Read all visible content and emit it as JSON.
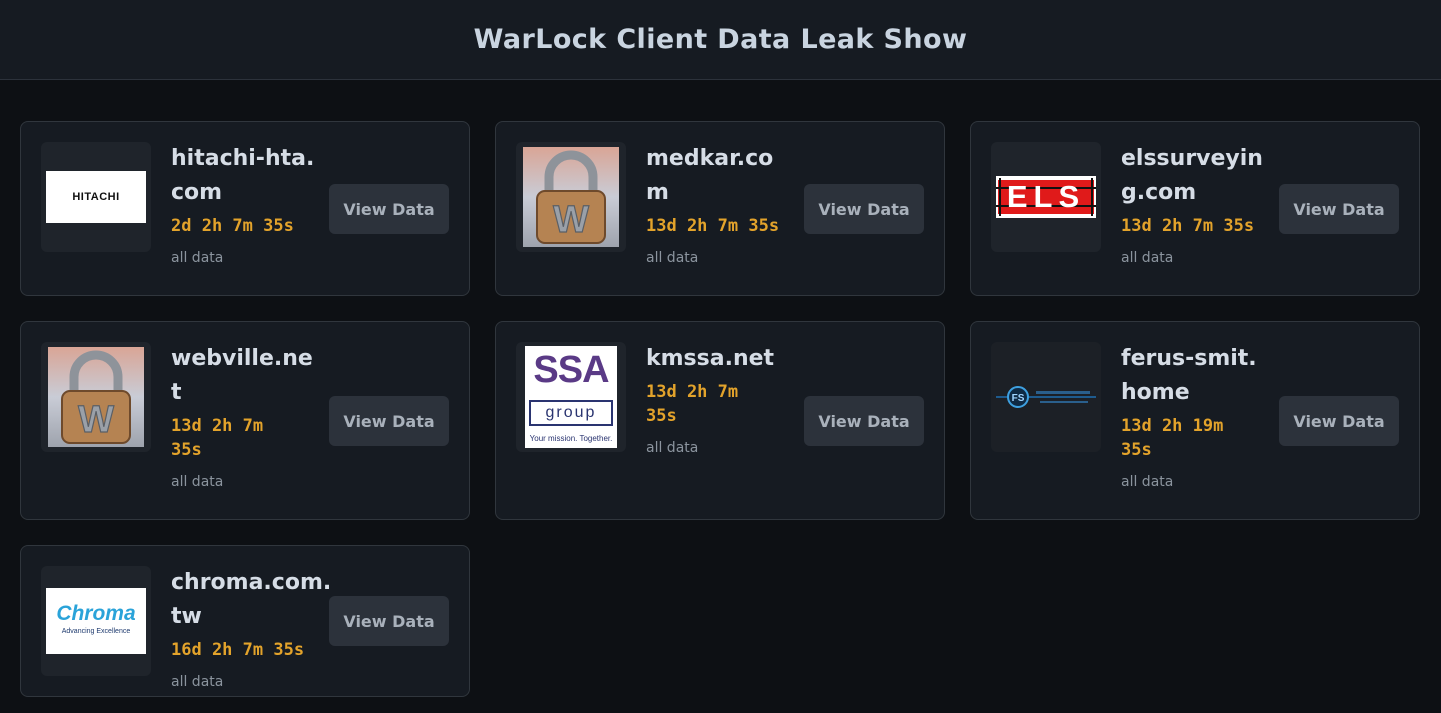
{
  "header": {
    "title": "WarLock Client Data Leak Show"
  },
  "cards": [
    {
      "domain": "hitachi-hta.com",
      "timer": "2d 2h 7m 35s",
      "desc": "all data",
      "button": "View Data",
      "logo_text": "HITACHI",
      "logo": "hitachi-logo"
    },
    {
      "domain": "medkar.com",
      "timer": "13d 2h 7m 35s",
      "desc": "all data",
      "button": "View Data",
      "logo": "padlock-w-logo"
    },
    {
      "domain": "elssurveying.com",
      "timer": "13d 2h 7m 35s",
      "desc": "all data",
      "button": "View Data",
      "logo_text": "ELS",
      "logo": "els-logo"
    },
    {
      "domain": "webville.net",
      "timer": "13d 2h 7m 35s",
      "desc": "all data",
      "button": "View Data",
      "logo": "padlock-w-logo"
    },
    {
      "domain": "kmssa.net",
      "timer": "13d 2h 7m 35s",
      "desc": "all data",
      "button": "View Data",
      "logo_text": "SSA",
      "logo_subtext": "group",
      "logo_tagline": "Your mission. Together.",
      "logo": "ssa-group-logo"
    },
    {
      "domain": "ferus-smit.home",
      "timer": "13d 2h 19m 35s",
      "desc": "all data",
      "button": "View Data",
      "logo": "ferus-smit-logo"
    },
    {
      "domain": "chroma.com.tw",
      "timer": "16d 2h 7m 35s",
      "desc": "all data",
      "button": "View Data",
      "logo_text": "Chroma",
      "logo_tagline": "Advancing Excellence",
      "logo": "chroma-logo"
    }
  ],
  "colors": {
    "accent_timer": "#e3a32b",
    "card_bg": "#161b22",
    "page_bg": "#0d1014",
    "button_bg": "#2c323b"
  }
}
